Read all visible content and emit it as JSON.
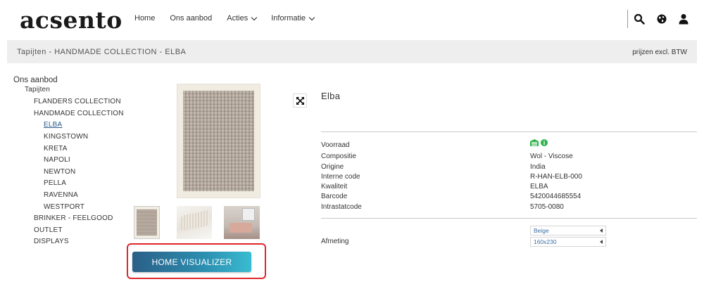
{
  "header": {
    "logo": "acsento",
    "nav": [
      {
        "label": "Home"
      },
      {
        "label": "Ons aanbod"
      },
      {
        "label": "Acties"
      },
      {
        "label": "Informatie"
      }
    ],
    "icons": [
      "search-icon",
      "globe-icon",
      "user-icon"
    ]
  },
  "breadcrumb": {
    "text": "Tapijten - HANDMADE COLLECTION - ELBA",
    "price_note": "prijzen excl. BTW"
  },
  "sidebar": {
    "root": "Ons aanbod",
    "category": "Tapijten",
    "collections": [
      "FLANDERS COLLECTION",
      "HANDMADE COLLECTION"
    ],
    "handmade_items": [
      "ELBA",
      "KINGSTOWN",
      "KRETA",
      "NAPOLI",
      "NEWTON",
      "PELLA",
      "RAVENNA",
      "WESTPORT"
    ],
    "other_items": [
      "BRINKER - FEELGOOD",
      "OUTLET",
      "DISPLAYS"
    ],
    "active_item": "ELBA"
  },
  "product": {
    "title": "Elba",
    "visualizer_label": "HOME VISUALIZER",
    "specs": [
      {
        "label": "Voorraad",
        "value": ""
      },
      {
        "label": "Compositie",
        "value": "Wol - Viscose"
      },
      {
        "label": "Origine",
        "value": "India"
      },
      {
        "label": "Interne code",
        "value": "R-HAN-ELB-000"
      },
      {
        "label": "Kwaliteit",
        "value": "ELBA"
      },
      {
        "label": "Barcode",
        "value": "5420044685554"
      },
      {
        "label": "Intrastatcode",
        "value": "5705-0080"
      }
    ],
    "afmeting_label": "Afmeting",
    "color_select": "Beige",
    "size_select": "160x230"
  },
  "colors": {
    "stock_green": "#2db34a",
    "highlight_red": "#e0262b",
    "button_start": "#2b5f87",
    "button_end": "#39bcd1"
  }
}
